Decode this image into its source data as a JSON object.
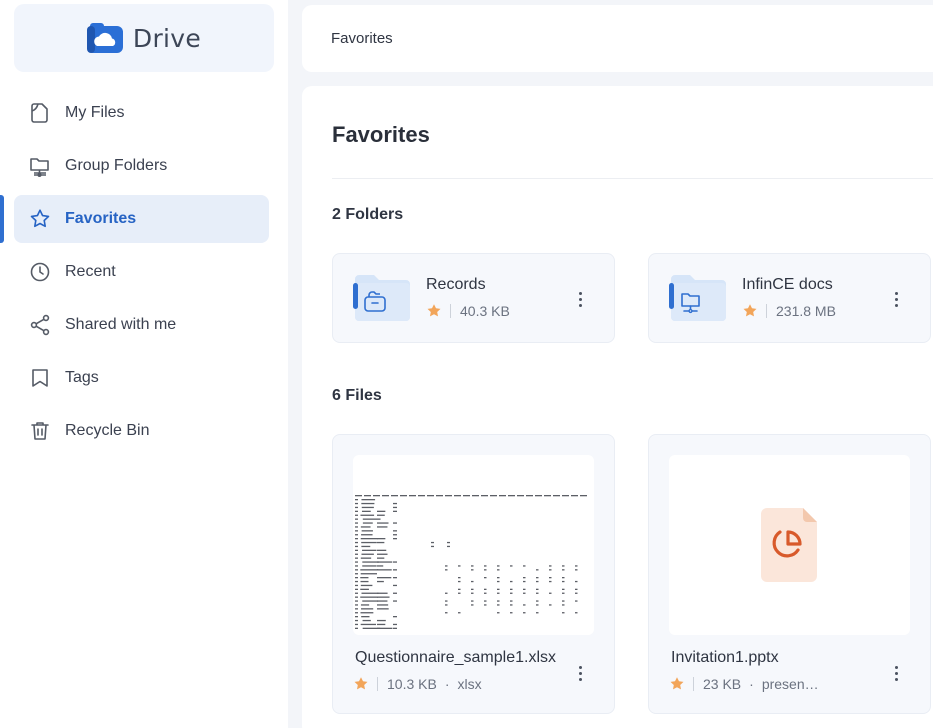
{
  "app": {
    "name": "Drive",
    "accent": "#2f6fd0",
    "star_color": "#f2a55a"
  },
  "sidebar": {
    "items": [
      {
        "label": "My Files",
        "icon": "file-icon",
        "active": false
      },
      {
        "label": "Group Folders",
        "icon": "group-folder-icon",
        "active": false
      },
      {
        "label": "Favorites",
        "icon": "star-icon",
        "active": true
      },
      {
        "label": "Recent",
        "icon": "clock-icon",
        "active": false
      },
      {
        "label": "Shared with me",
        "icon": "share-icon",
        "active": false
      },
      {
        "label": "Tags",
        "icon": "tag-icon",
        "active": false
      },
      {
        "label": "Recycle Bin",
        "icon": "trash-icon",
        "active": false
      }
    ]
  },
  "breadcrumb": {
    "current": "Favorites"
  },
  "main": {
    "title": "Favorites",
    "folders_heading": "2 Folders",
    "folders": [
      {
        "name": "Records",
        "size": "40.3 KB",
        "favorite": true,
        "icon": "folder-lock-icon"
      },
      {
        "name": "InfinCE docs",
        "size": "231.8 MB",
        "favorite": true,
        "icon": "folder-network-icon"
      }
    ],
    "files_heading": "6 Files",
    "files": [
      {
        "name": "Questionnaire_sample1.xlsx",
        "size": "10.3 KB",
        "type": "xlsx",
        "favorite": true,
        "thumbnail": "spreadsheet-preview"
      },
      {
        "name": "Invitation1.pptx",
        "size": "23 KB",
        "type": "presen…",
        "favorite": true,
        "thumbnail": "presentation-file-icon"
      }
    ]
  }
}
